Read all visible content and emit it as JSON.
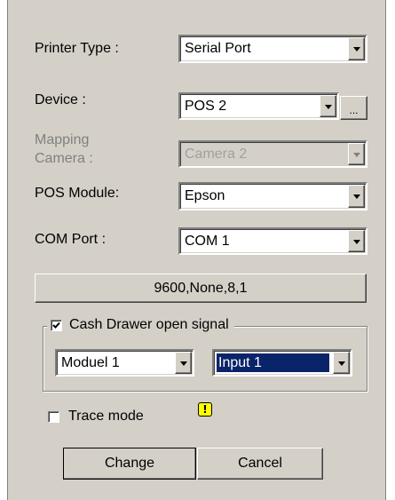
{
  "fields": {
    "printer_type": {
      "label": "Printer Type :",
      "value": "Serial Port"
    },
    "device": {
      "label": "Device :",
      "value": "POS 2",
      "browse_label": "..."
    },
    "mapping_camera": {
      "label_line1": "Mapping",
      "label_line2": "Camera :",
      "value": "Camera 2"
    },
    "pos_module": {
      "label": "POS Module:",
      "value": "Epson"
    },
    "com_port": {
      "label": "COM Port :",
      "value": "COM 1"
    }
  },
  "serial_settings_button": "9600,None,8,1",
  "cash_drawer": {
    "label": "Cash Drawer open signal",
    "checked": true,
    "module_value": "Moduel 1",
    "input_value": "Input 1"
  },
  "trace_mode": {
    "label": "Trace mode",
    "checked": false,
    "icon": "warning-icon"
  },
  "buttons": {
    "change": "Change",
    "cancel": "Cancel"
  },
  "colors": {
    "dialog_bg": "#d4d0c8",
    "selection": "#0a246a",
    "warning": "#ffff00"
  }
}
